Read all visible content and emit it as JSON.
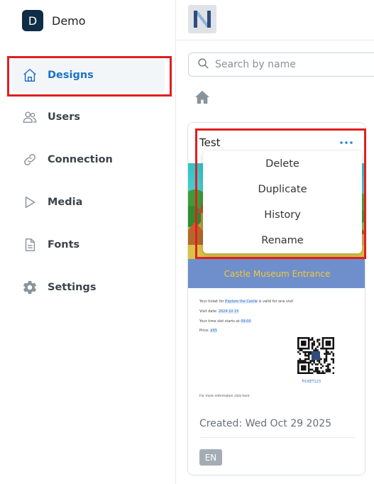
{
  "workspace": {
    "initial": "D",
    "name": "Demo"
  },
  "sidebar": {
    "items": [
      {
        "label": "Designs",
        "icon": "home-icon",
        "active": true
      },
      {
        "label": "Users",
        "icon": "users-icon",
        "active": false
      },
      {
        "label": "Connection",
        "icon": "link-icon",
        "active": false
      },
      {
        "label": "Media",
        "icon": "play-icon",
        "active": false
      },
      {
        "label": "Fonts",
        "icon": "document-icon",
        "active": false
      },
      {
        "label": "Settings",
        "icon": "gear-icon",
        "active": false
      }
    ]
  },
  "search": {
    "placeholder": "Search by name",
    "value": ""
  },
  "card": {
    "title": "Test",
    "banner_text": "Castle Museum Entrance",
    "ticket_lines": [
      [
        "Your ticket for ",
        "Explore the Castle",
        " is valid for one visit"
      ],
      [
        "Visit date: ",
        "2024 10 15",
        ""
      ],
      [
        "Your time slot starts at ",
        "09:00",
        ""
      ],
      [
        "Price: ",
        "£65",
        ""
      ]
    ],
    "ticket_code": "TICKET123",
    "more_info": "For more information click here",
    "created": "Created: Wed Oct 29 2025",
    "language": "EN"
  },
  "menu": {
    "items": [
      "Delete",
      "Duplicate",
      "History",
      "Rename"
    ]
  },
  "colors": {
    "accent": "#1d72c6",
    "highlight_box": "#e01f1f",
    "workspace_avatar": "#0f2d45",
    "banner_bg": "#6f8fcc",
    "banner_text": "#f2c832"
  }
}
